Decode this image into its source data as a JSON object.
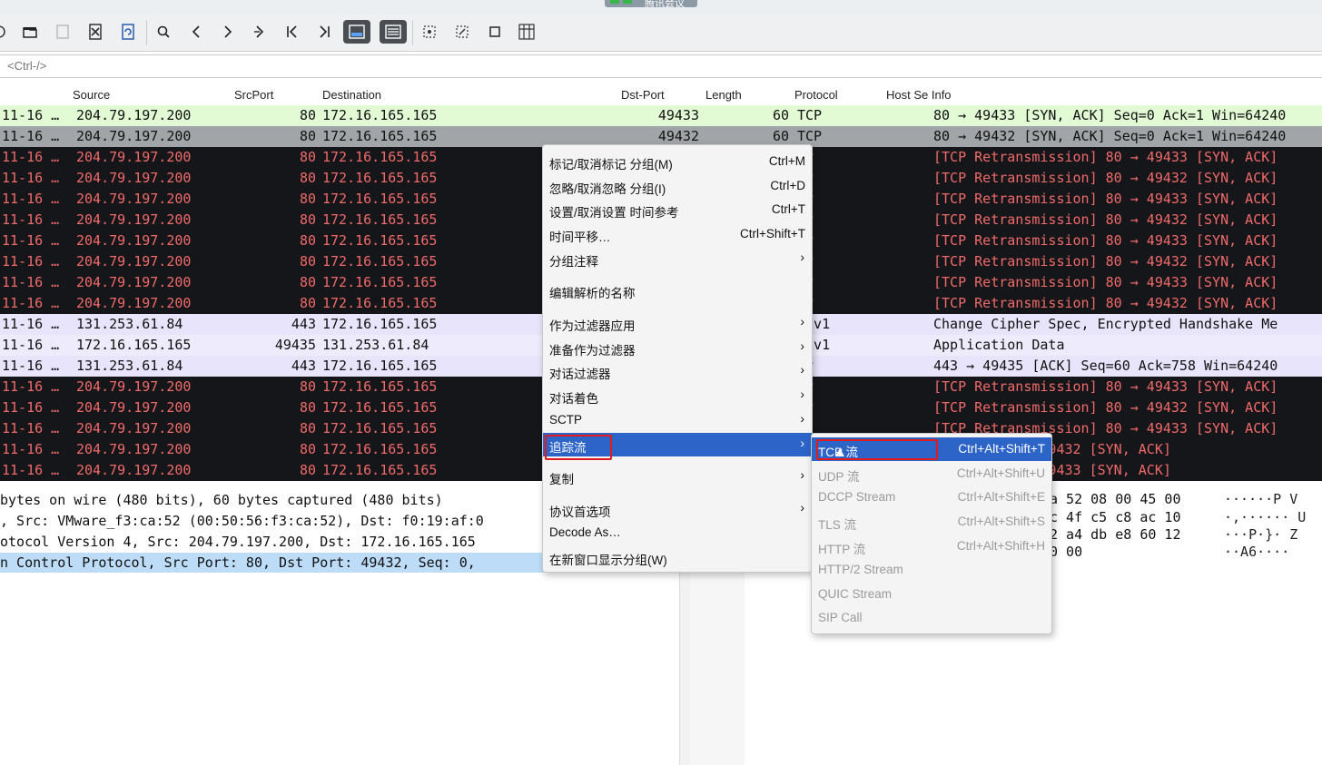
{
  "meeting_banner": "腾讯会议",
  "filter": {
    "placeholder": "<Ctrl-/>"
  },
  "columns": [
    "Source",
    "SrcPort",
    "Destination",
    "Dst-Port",
    "Length",
    "Protocol",
    "Host Se Info"
  ],
  "packets": [
    {
      "time": "11-16 …",
      "src": "204.79.197.200",
      "sport": "80",
      "dst": "172.16.165.165",
      "dport": "49433",
      "len": "60",
      "proto": "TCP",
      "info": "80 → 49433 [SYN, ACK] Seq=0 Ack=1 Win=64240"
    },
    {
      "time": "11-16 …",
      "src": "204.79.197.200",
      "sport": "80",
      "dst": "172.16.165.165",
      "dport": "49432",
      "len": "60",
      "proto": "TCP",
      "info": "80 → 49432 [SYN, ACK] Seq=0 Ack=1 Win=64240"
    },
    {
      "time": "11-16 …",
      "src": "204.79.197.200",
      "sport": "80",
      "dst": "172.16.165.165",
      "dport": "",
      "len": "",
      "proto": "CP",
      "info": "[TCP Retransmission] 80 → 49433 [SYN, ACK]"
    },
    {
      "time": "11-16 …",
      "src": "204.79.197.200",
      "sport": "80",
      "dst": "172.16.165.165",
      "dport": "",
      "len": "",
      "proto": "CP",
      "info": "[TCP Retransmission] 80 → 49432 [SYN, ACK]"
    },
    {
      "time": "11-16 …",
      "src": "204.79.197.200",
      "sport": "80",
      "dst": "172.16.165.165",
      "dport": "",
      "len": "",
      "proto": "CP",
      "info": "[TCP Retransmission] 80 → 49433 [SYN, ACK]"
    },
    {
      "time": "11-16 …",
      "src": "204.79.197.200",
      "sport": "80",
      "dst": "172.16.165.165",
      "dport": "",
      "len": "",
      "proto": "CP",
      "info": "[TCP Retransmission] 80 → 49432 [SYN, ACK]"
    },
    {
      "time": "11-16 …",
      "src": "204.79.197.200",
      "sport": "80",
      "dst": "172.16.165.165",
      "dport": "",
      "len": "",
      "proto": "CP",
      "info": "[TCP Retransmission] 80 → 49433 [SYN, ACK]"
    },
    {
      "time": "11-16 …",
      "src": "204.79.197.200",
      "sport": "80",
      "dst": "172.16.165.165",
      "dport": "",
      "len": "",
      "proto": "CP",
      "info": "[TCP Retransmission] 80 → 49432 [SYN, ACK]"
    },
    {
      "time": "11-16 …",
      "src": "204.79.197.200",
      "sport": "80",
      "dst": "172.16.165.165",
      "dport": "",
      "len": "",
      "proto": "CP",
      "info": "[TCP Retransmission] 80 → 49433 [SYN, ACK]"
    },
    {
      "time": "11-16 …",
      "src": "204.79.197.200",
      "sport": "80",
      "dst": "172.16.165.165",
      "dport": "",
      "len": "",
      "proto": "CP",
      "info": "[TCP Retransmission] 80 → 49432 [SYN, ACK]"
    },
    {
      "time": "11-16 …",
      "src": "131.253.61.84",
      "sport": "443",
      "dst": "172.16.165.165",
      "dport": "",
      "len": "",
      "proto": "LSv1",
      "info": "Change Cipher Spec, Encrypted Handshake Me"
    },
    {
      "time": "11-16 …",
      "src": "172.16.165.165",
      "sport": "49435",
      "dst": "131.253.61.84",
      "dport": "",
      "len": "",
      "proto": "LSv1",
      "info": "Application Data"
    },
    {
      "time": "11-16 …",
      "src": "131.253.61.84",
      "sport": "443",
      "dst": "172.16.165.165",
      "dport": "",
      "len": "",
      "proto": "CP",
      "info": "443 → 49435 [ACK] Seq=60 Ack=758 Win=64240"
    },
    {
      "time": "11-16 …",
      "src": "204.79.197.200",
      "sport": "80",
      "dst": "172.16.165.165",
      "dport": "",
      "len": "",
      "proto": "CP",
      "info": "[TCP Retransmission] 80 → 49433 [SYN, ACK]"
    },
    {
      "time": "11-16 …",
      "src": "204.79.197.200",
      "sport": "80",
      "dst": "172.16.165.165",
      "dport": "",
      "len": "",
      "proto": "CP",
      "info": "[TCP Retransmission] 80 → 49432 [SYN, ACK]"
    },
    {
      "time": "11-16 …",
      "src": "204.79.197.200",
      "sport": "80",
      "dst": "172.16.165.165",
      "dport": "",
      "len": "",
      "proto": "P",
      "info": "[TCP Retransmission] 80 → 49433 [SYN, ACK]"
    },
    {
      "time": "11-16 …",
      "src": "204.79.197.200",
      "sport": "80",
      "dst": "172.16.165.165",
      "dport": "",
      "len": "",
      "proto": "",
      "info": "ission] 80 → 49432 [SYN, ACK]"
    },
    {
      "time": "11-16 …",
      "src": "204.79.197.200",
      "sport": "80",
      "dst": "172.16.165.165",
      "dport": "",
      "len": "",
      "proto": "",
      "info": "ission] 80 → 49433 [SYN, ACK]"
    }
  ],
  "details": [
    " bytes on wire (480 bits), 60 bytes captured (480 bits)",
    ", Src: VMware_f3:ca:52 (00:50:56:f3:ca:52), Dst: f0:19:af:0",
    "otocol Version 4, Src: 204.79.197.200, Dst: 172.16.165.165",
    "n Control Protocol, Src Port: 80, Dst Port: 49432, Seq: 0,"
  ],
  "bytes": [
    {
      "hex": "a 52 08 00 45 00",
      "ascii": "······P V"
    },
    {
      "hex": "c 4f c5 c8 ac 10",
      "ascii": "·,······ U"
    },
    {
      "hex": "2 a4 db e8 60 12",
      "ascii": "···P·}·  Z"
    },
    {
      "hex": "0 00",
      "ascii": "··A6····"
    }
  ],
  "context_menu": [
    {
      "label": "标记/取消标记 分组(M)",
      "shortcut": "Ctrl+M"
    },
    {
      "label": "忽略/取消忽略 分组(I)",
      "shortcut": "Ctrl+D"
    },
    {
      "label": "设置/取消设置 时间参考",
      "shortcut": "Ctrl+T"
    },
    {
      "label": "时间平移…",
      "shortcut": "Ctrl+Shift+T"
    },
    {
      "label": "分组注释",
      "shortcut": "",
      "submenu": true
    },
    {
      "label": "编辑解析的名称",
      "shortcut": ""
    },
    {
      "label": "作为过滤器应用",
      "shortcut": "",
      "submenu": true
    },
    {
      "label": "准备作为过滤器",
      "shortcut": "",
      "submenu": true
    },
    {
      "label": "对话过滤器",
      "shortcut": "",
      "submenu": true
    },
    {
      "label": "对话着色",
      "shortcut": "",
      "submenu": true
    },
    {
      "label": "SCTP",
      "shortcut": "",
      "submenu": true
    },
    {
      "label": "追踪流",
      "shortcut": "",
      "submenu": true,
      "active": true
    },
    {
      "label": "复制",
      "shortcut": "",
      "submenu": true
    },
    {
      "label": "协议首选项",
      "shortcut": "",
      "submenu": true
    },
    {
      "label": "Decode As…",
      "shortcut": ""
    },
    {
      "label": "在新窗口显示分组(W)",
      "shortcut": ""
    }
  ],
  "follow_submenu": [
    {
      "label": "TCP 流",
      "shortcut": "Ctrl+Alt+Shift+T",
      "active": true
    },
    {
      "label": "UDP 流",
      "shortcut": "Ctrl+Alt+Shift+U"
    },
    {
      "label": "DCCP Stream",
      "shortcut": "Ctrl+Alt+Shift+E"
    },
    {
      "label": "TLS 流",
      "shortcut": "Ctrl+Alt+Shift+S"
    },
    {
      "label": "HTTP 流",
      "shortcut": "Ctrl+Alt+Shift+H"
    },
    {
      "label": "HTTP/2 Stream",
      "shortcut": ""
    },
    {
      "label": "QUIC Stream",
      "shortcut": ""
    },
    {
      "label": "SIP Call",
      "shortcut": ""
    }
  ],
  "colors": {
    "row_green": "#e2fbd4",
    "row_gray": "#a2a5a8",
    "row_black": "#14161a",
    "row_black_text": "#f06a6a",
    "row_lavender": "#e8e4fb",
    "menu_active": "#2c64c8",
    "highlight_box": "#e01b1b"
  },
  "toolbar_icons": [
    "circle-partial-icon",
    "folder-open-icon",
    "save-icon",
    "close-file-icon",
    "reload-icon",
    "find-icon",
    "back-icon",
    "forward-icon",
    "go-to-packet-icon",
    "first-packet-icon",
    "last-packet-icon",
    "autoscroll-icon",
    "colorize-icon",
    "zoom-in-icon",
    "zoom-out-icon",
    "normal-size-icon",
    "resize-columns-icon"
  ]
}
